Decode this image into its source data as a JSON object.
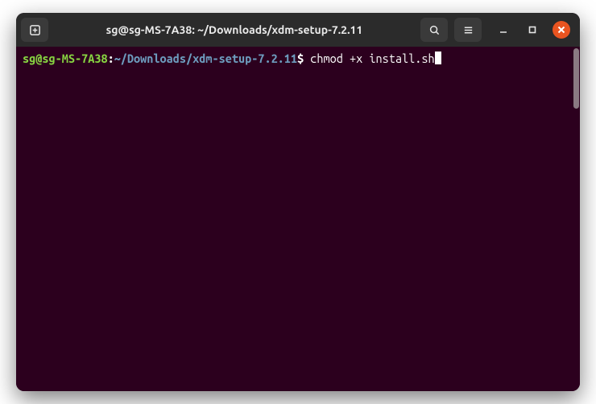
{
  "titlebar": {
    "title": "sg@sg-MS-7A38: ~/Downloads/xdm-setup-7.2.11"
  },
  "prompt": {
    "user_host": "sg@sg-MS-7A38",
    "colon": ":",
    "path": "~/Downloads/xdm-setup-7.2.11",
    "symbol": "$ ",
    "command": "chmod +x install.sh"
  },
  "icons": {
    "new_tab": "new-tab-icon",
    "search": "search-icon",
    "menu": "hamburger-menu-icon",
    "minimize": "minimize-icon",
    "maximize": "maximize-icon",
    "close": "close-icon"
  }
}
